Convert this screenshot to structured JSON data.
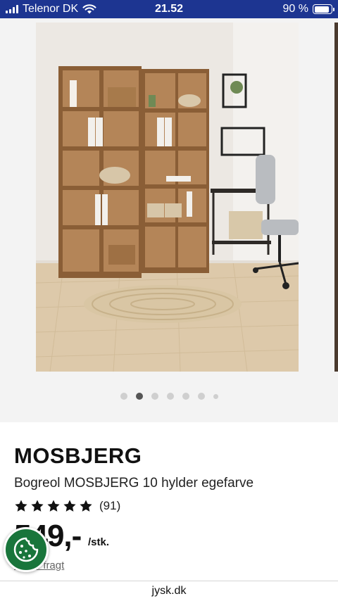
{
  "status_bar": {
    "carrier": "Telenor DK",
    "time": "21.52",
    "battery": "90 %",
    "battery_level": 0.9
  },
  "gallery": {
    "image_alt": "Bogreol MOSBJERG 10 hylder egefarve",
    "dot_count": 7,
    "active_index": 1
  },
  "product": {
    "brand": "MOSBJERG",
    "description": "Bogreol MOSBJERG 10 hylder egefarve",
    "rating_stars": 5,
    "rating_count": "(91)",
    "price": "549,-",
    "unit": "/stk.",
    "freight_link": "+ evt. fragt"
  },
  "cookie_button": {
    "icon": "cookie-icon"
  },
  "url_bar": {
    "domain": "jysk.dk"
  },
  "colors": {
    "status_bar_bg": "#1d3591",
    "cookie_bg": "#19753b",
    "gallery_bg": "#f3f3f3"
  }
}
